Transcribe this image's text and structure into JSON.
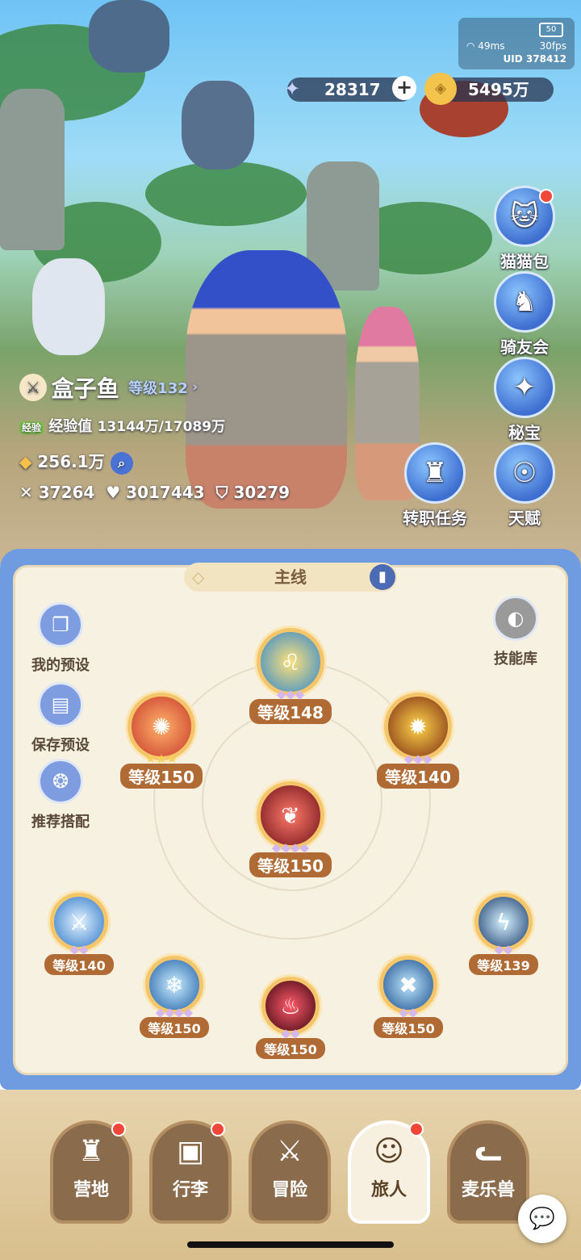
{
  "status": {
    "battery": "50",
    "ping": "49ms",
    "fps": "30fps",
    "uid": "UID 378412"
  },
  "resources": {
    "stars": "28317",
    "coins": "5495万"
  },
  "player": {
    "name": "盒子鱼",
    "level": "等级132",
    "exp_tag": "经验",
    "exp_label": "经验值",
    "exp_value": "13144万/17089万",
    "power": "256.1万",
    "attack": "37264",
    "hp": "3017443",
    "defense": "30279"
  },
  "right_menu": [
    {
      "label": "猫猫包"
    },
    {
      "label": "骑友会"
    },
    {
      "label": "秘宝"
    },
    {
      "label": "天赋"
    }
  ],
  "job_quest": "转职任务",
  "panel": {
    "tab": "主线",
    "skill_library": "技能库",
    "left": [
      "我的预设",
      "保存预设",
      "推荐搭配"
    ]
  },
  "skills": [
    {
      "level": "等级148",
      "stars": "◆◆◆"
    },
    {
      "level": "等级150",
      "stars": "★★★"
    },
    {
      "level": "等级140",
      "stars": "◆◆◆"
    },
    {
      "level": "等级150",
      "stars": "◆◆◆◆"
    },
    {
      "level": "等级140",
      "stars": "◆◆"
    },
    {
      "level": "等级139",
      "stars": "◆◆"
    },
    {
      "level": "等级150",
      "stars": "◆◆◆◆"
    },
    {
      "level": "等级150",
      "stars": "◆◆"
    },
    {
      "level": "等级150",
      "stars": "◆◆"
    }
  ],
  "bottom_nav": [
    {
      "label": "营地"
    },
    {
      "label": "行李"
    },
    {
      "label": "冒险"
    },
    {
      "label": "旅人"
    },
    {
      "label": "麦乐兽"
    }
  ],
  "colors": {
    "panel_blue": "#6f9be0",
    "panel_bg": "#f7f1e2",
    "level_pill": "#b06a34"
  }
}
